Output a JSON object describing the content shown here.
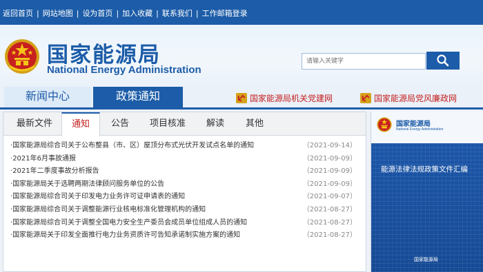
{
  "topbar": {
    "links": [
      "返回首页",
      "网站地图",
      "设为首页",
      "加入收藏",
      "联系我们",
      "工作邮箱登录"
    ]
  },
  "header": {
    "title_cn": "国家能源局",
    "title_en": "National Energy Administration",
    "search_placeholder": "请输入关键字",
    "brand_color": "#1c5ca8",
    "search_button_icon": "search-icon",
    "emblem_icon": "national-emblem-icon"
  },
  "nav": {
    "tab1": "新闻中心",
    "tab2": "政策通知",
    "party_link1": "国家能源局机关党建网",
    "party_link2": "国家能源局党风廉政网",
    "party_icon": "party-emblem-icon"
  },
  "tabs": [
    "最新文件",
    "通知",
    "公告",
    "项目核准",
    "解读",
    "其他"
  ],
  "active_tab": "通知",
  "notices": [
    {
      "title": "国家能源局综合司关于公布整县（市、区）屋顶分布式光伏开发试点名单的通知",
      "date": "（2021-09-14）"
    },
    {
      "title": "2021年6月事故通报",
      "date": "（2021-09-09）"
    },
    {
      "title": "2021年二季度事故分析报告",
      "date": "（2021-09-09）"
    },
    {
      "title": "国家能源局关于选聘两期法律顾问服务单位的公告",
      "date": "（2021-09-09）"
    },
    {
      "title": "国家能源局综合司关于印发电力业务许可证申请表的通知",
      "date": "（2021-09-07）"
    },
    {
      "title": "国家能源局综合司关于调整能源行业核电标准化管理机构的通知",
      "date": "（2021-08-27）"
    },
    {
      "title": "国家能源局综合司关于调整全国电力安全生产委员会成员单位组成人员的通知",
      "date": "（2021-08-27）"
    },
    {
      "title": "国家能源局关于印发全面推行电力业务资质许可告知承诺制实施方案的通知",
      "date": "（2021-08-27）"
    }
  ],
  "banner": {
    "logo_cn": "国家能源局",
    "logo_en": "National Energy Administration",
    "title": "能源法律法规政策文件汇编",
    "footer": "国家能源局"
  }
}
